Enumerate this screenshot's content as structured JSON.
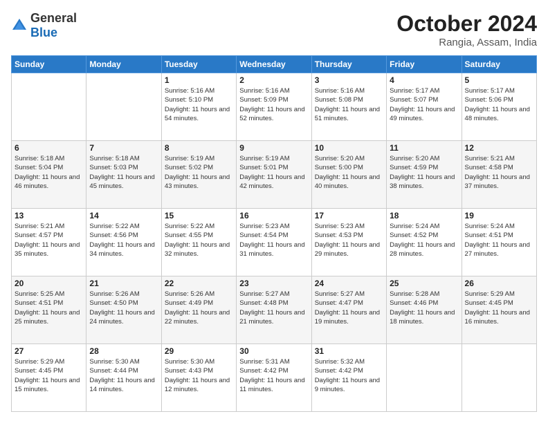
{
  "header": {
    "logo": {
      "general": "General",
      "blue": "Blue"
    },
    "title": "October 2024",
    "location": "Rangia, Assam, India"
  },
  "weekdays": [
    "Sunday",
    "Monday",
    "Tuesday",
    "Wednesday",
    "Thursday",
    "Friday",
    "Saturday"
  ],
  "weeks": [
    [
      {
        "day": null
      },
      {
        "day": null
      },
      {
        "day": "1",
        "sunrise": "Sunrise: 5:16 AM",
        "sunset": "Sunset: 5:10 PM",
        "daylight": "Daylight: 11 hours and 54 minutes."
      },
      {
        "day": "2",
        "sunrise": "Sunrise: 5:16 AM",
        "sunset": "Sunset: 5:09 PM",
        "daylight": "Daylight: 11 hours and 52 minutes."
      },
      {
        "day": "3",
        "sunrise": "Sunrise: 5:16 AM",
        "sunset": "Sunset: 5:08 PM",
        "daylight": "Daylight: 11 hours and 51 minutes."
      },
      {
        "day": "4",
        "sunrise": "Sunrise: 5:17 AM",
        "sunset": "Sunset: 5:07 PM",
        "daylight": "Daylight: 11 hours and 49 minutes."
      },
      {
        "day": "5",
        "sunrise": "Sunrise: 5:17 AM",
        "sunset": "Sunset: 5:06 PM",
        "daylight": "Daylight: 11 hours and 48 minutes."
      }
    ],
    [
      {
        "day": "6",
        "sunrise": "Sunrise: 5:18 AM",
        "sunset": "Sunset: 5:04 PM",
        "daylight": "Daylight: 11 hours and 46 minutes."
      },
      {
        "day": "7",
        "sunrise": "Sunrise: 5:18 AM",
        "sunset": "Sunset: 5:03 PM",
        "daylight": "Daylight: 11 hours and 45 minutes."
      },
      {
        "day": "8",
        "sunrise": "Sunrise: 5:19 AM",
        "sunset": "Sunset: 5:02 PM",
        "daylight": "Daylight: 11 hours and 43 minutes."
      },
      {
        "day": "9",
        "sunrise": "Sunrise: 5:19 AM",
        "sunset": "Sunset: 5:01 PM",
        "daylight": "Daylight: 11 hours and 42 minutes."
      },
      {
        "day": "10",
        "sunrise": "Sunrise: 5:20 AM",
        "sunset": "Sunset: 5:00 PM",
        "daylight": "Daylight: 11 hours and 40 minutes."
      },
      {
        "day": "11",
        "sunrise": "Sunrise: 5:20 AM",
        "sunset": "Sunset: 4:59 PM",
        "daylight": "Daylight: 11 hours and 38 minutes."
      },
      {
        "day": "12",
        "sunrise": "Sunrise: 5:21 AM",
        "sunset": "Sunset: 4:58 PM",
        "daylight": "Daylight: 11 hours and 37 minutes."
      }
    ],
    [
      {
        "day": "13",
        "sunrise": "Sunrise: 5:21 AM",
        "sunset": "Sunset: 4:57 PM",
        "daylight": "Daylight: 11 hours and 35 minutes."
      },
      {
        "day": "14",
        "sunrise": "Sunrise: 5:22 AM",
        "sunset": "Sunset: 4:56 PM",
        "daylight": "Daylight: 11 hours and 34 minutes."
      },
      {
        "day": "15",
        "sunrise": "Sunrise: 5:22 AM",
        "sunset": "Sunset: 4:55 PM",
        "daylight": "Daylight: 11 hours and 32 minutes."
      },
      {
        "day": "16",
        "sunrise": "Sunrise: 5:23 AM",
        "sunset": "Sunset: 4:54 PM",
        "daylight": "Daylight: 11 hours and 31 minutes."
      },
      {
        "day": "17",
        "sunrise": "Sunrise: 5:23 AM",
        "sunset": "Sunset: 4:53 PM",
        "daylight": "Daylight: 11 hours and 29 minutes."
      },
      {
        "day": "18",
        "sunrise": "Sunrise: 5:24 AM",
        "sunset": "Sunset: 4:52 PM",
        "daylight": "Daylight: 11 hours and 28 minutes."
      },
      {
        "day": "19",
        "sunrise": "Sunrise: 5:24 AM",
        "sunset": "Sunset: 4:51 PM",
        "daylight": "Daylight: 11 hours and 27 minutes."
      }
    ],
    [
      {
        "day": "20",
        "sunrise": "Sunrise: 5:25 AM",
        "sunset": "Sunset: 4:51 PM",
        "daylight": "Daylight: 11 hours and 25 minutes."
      },
      {
        "day": "21",
        "sunrise": "Sunrise: 5:26 AM",
        "sunset": "Sunset: 4:50 PM",
        "daylight": "Daylight: 11 hours and 24 minutes."
      },
      {
        "day": "22",
        "sunrise": "Sunrise: 5:26 AM",
        "sunset": "Sunset: 4:49 PM",
        "daylight": "Daylight: 11 hours and 22 minutes."
      },
      {
        "day": "23",
        "sunrise": "Sunrise: 5:27 AM",
        "sunset": "Sunset: 4:48 PM",
        "daylight": "Daylight: 11 hours and 21 minutes."
      },
      {
        "day": "24",
        "sunrise": "Sunrise: 5:27 AM",
        "sunset": "Sunset: 4:47 PM",
        "daylight": "Daylight: 11 hours and 19 minutes."
      },
      {
        "day": "25",
        "sunrise": "Sunrise: 5:28 AM",
        "sunset": "Sunset: 4:46 PM",
        "daylight": "Daylight: 11 hours and 18 minutes."
      },
      {
        "day": "26",
        "sunrise": "Sunrise: 5:29 AM",
        "sunset": "Sunset: 4:45 PM",
        "daylight": "Daylight: 11 hours and 16 minutes."
      }
    ],
    [
      {
        "day": "27",
        "sunrise": "Sunrise: 5:29 AM",
        "sunset": "Sunset: 4:45 PM",
        "daylight": "Daylight: 11 hours and 15 minutes."
      },
      {
        "day": "28",
        "sunrise": "Sunrise: 5:30 AM",
        "sunset": "Sunset: 4:44 PM",
        "daylight": "Daylight: 11 hours and 14 minutes."
      },
      {
        "day": "29",
        "sunrise": "Sunrise: 5:30 AM",
        "sunset": "Sunset: 4:43 PM",
        "daylight": "Daylight: 11 hours and 12 minutes."
      },
      {
        "day": "30",
        "sunrise": "Sunrise: 5:31 AM",
        "sunset": "Sunset: 4:42 PM",
        "daylight": "Daylight: 11 hours and 11 minutes."
      },
      {
        "day": "31",
        "sunrise": "Sunrise: 5:32 AM",
        "sunset": "Sunset: 4:42 PM",
        "daylight": "Daylight: 11 hours and 9 minutes."
      },
      {
        "day": null
      },
      {
        "day": null
      }
    ]
  ]
}
